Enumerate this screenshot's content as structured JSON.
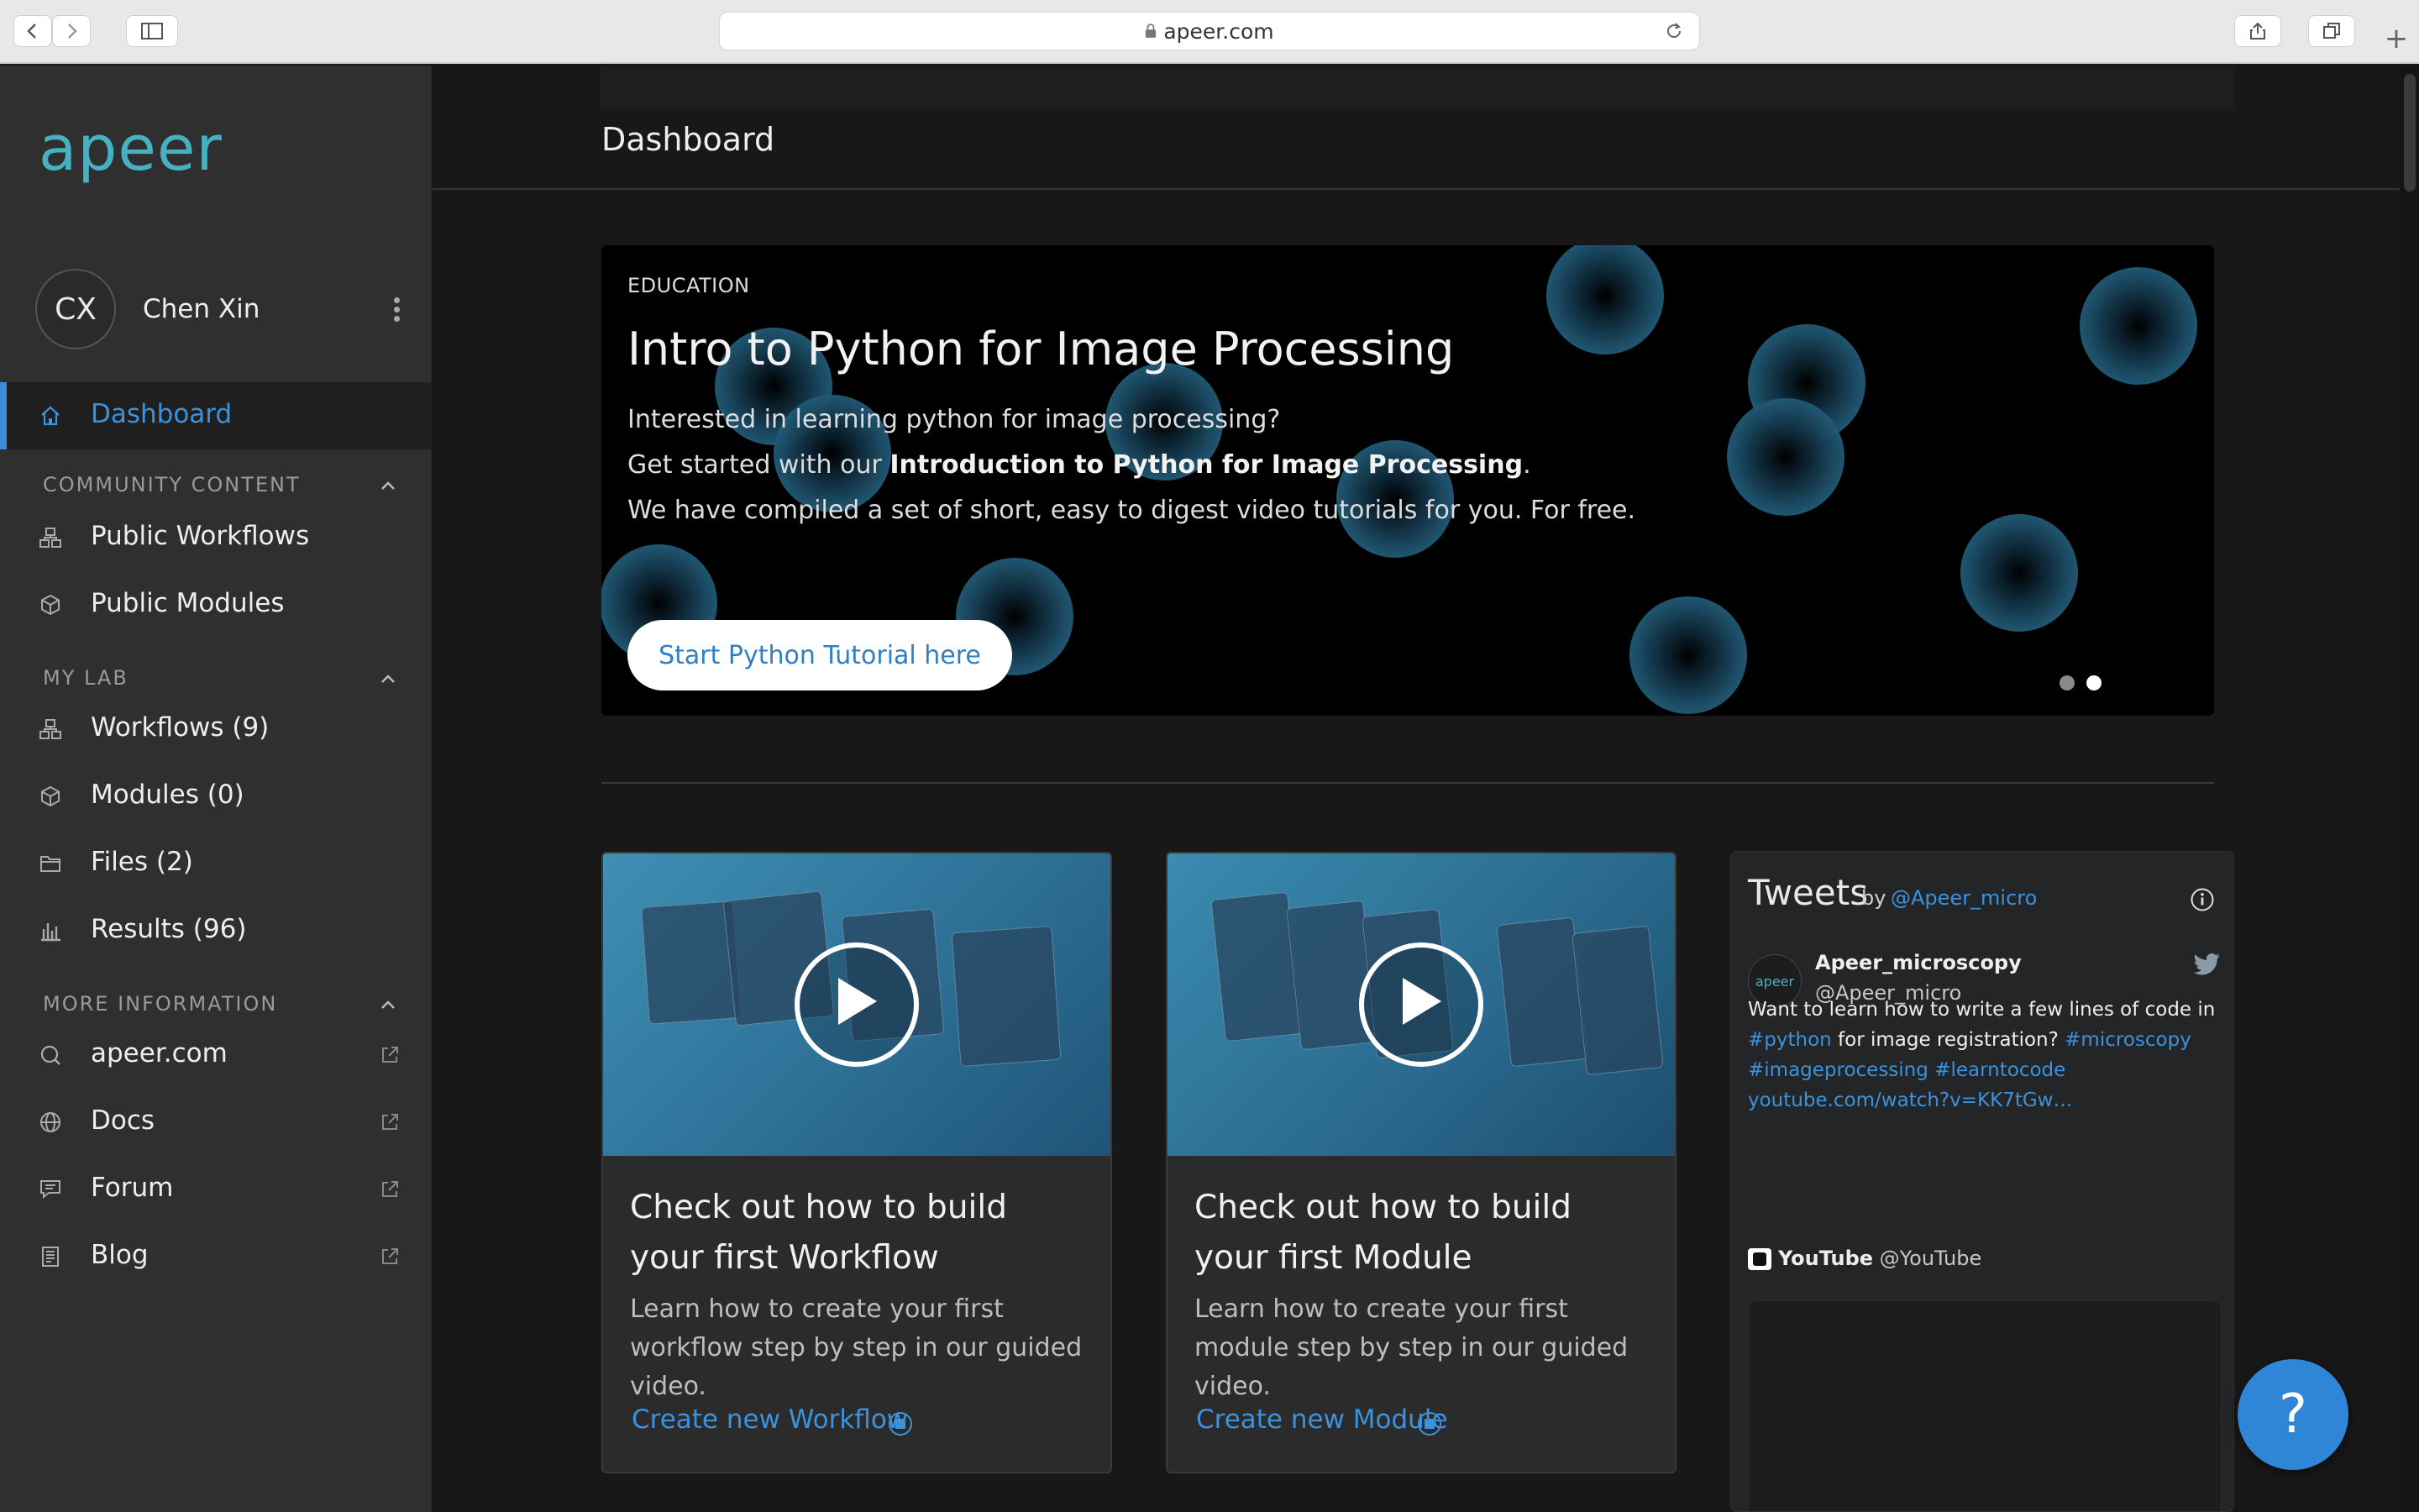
{
  "browser": {
    "url": "apeer.com"
  },
  "sidebar": {
    "logo": "apeer",
    "user": {
      "initials": "CX",
      "name": "Chen Xin"
    },
    "dashboard_label": "Dashboard",
    "sections": [
      {
        "title": "COMMUNITY CONTENT",
        "items": [
          {
            "label": "Public Workflows",
            "icon": "workflow-icon"
          },
          {
            "label": "Public Modules",
            "icon": "cube-icon"
          }
        ]
      },
      {
        "title": "MY LAB",
        "items": [
          {
            "label": "Workflows (9)",
            "icon": "workflow-icon"
          },
          {
            "label": "Modules (0)",
            "icon": "cube-icon"
          },
          {
            "label": "Files (2)",
            "icon": "folder-icon"
          },
          {
            "label": "Results (96)",
            "icon": "bar-chart-icon"
          }
        ]
      },
      {
        "title": "MORE INFORMATION",
        "items": [
          {
            "label": "apeer.com",
            "icon": "search-icon"
          },
          {
            "label": "Docs",
            "icon": "globe-icon"
          },
          {
            "label": "Forum",
            "icon": "chat-icon"
          },
          {
            "label": "Blog",
            "icon": "document-icon"
          }
        ]
      }
    ]
  },
  "main": {
    "page_title": "Dashboard",
    "banner": {
      "tag": "EDUCATION",
      "title": "Intro to Python for Image Processing",
      "line1": "Interested in learning python for image processing?",
      "line2_prefix": "Get started with our ",
      "line2_bold": "Introduction to Python for Image Processing",
      "line2_suffix": ".",
      "line3": "We have compiled a set of short, easy to digest video tutorials for you. For free.",
      "cta": "Start Python Tutorial here"
    },
    "cards": [
      {
        "title": "Check out how to build your first Workflow",
        "desc": "Learn how to create your first workflow step by step in our guided video.",
        "link": "Create new Workflow"
      },
      {
        "title": "Check out how to build your first Module",
        "desc": "Learn how to create your first module step by step in our guided video.",
        "link": "Create new Module"
      }
    ],
    "tweets": {
      "heading": "Tweets",
      "by": "by",
      "handle": "@Apeer_micro",
      "account_name": "Apeer_microscopy",
      "account_handle": "@Apeer_micro",
      "avatar_text": "apeer",
      "text_line1": "Want to learn how to write a few lines of code in",
      "tag_python": "#python",
      "text_mid": " for image registration? ",
      "tag_microscopy": "#microscopy",
      "tag_imageprocessing": "#imageprocessing",
      "tag_learntocode": "#learntocode",
      "link": "youtube.com/watch?v=KK7tGw…",
      "source_name": "YouTube",
      "source_handle": "@YouTube"
    },
    "help_label": "?"
  },
  "colors": {
    "accent": "#3b92dd",
    "logo": "#47b0c2",
    "sidebar_bg": "#2f2f2f",
    "main_bg": "#181818"
  }
}
